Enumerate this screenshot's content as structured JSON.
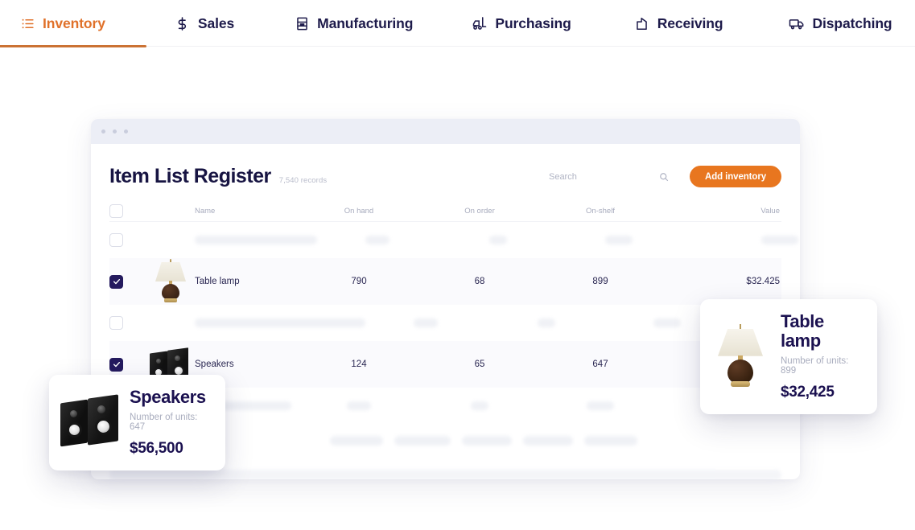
{
  "nav": {
    "items": [
      {
        "label": "Inventory",
        "icon": "list-icon",
        "active": true
      },
      {
        "label": "Sales",
        "icon": "dollar-icon",
        "active": false
      },
      {
        "label": "Manufacturing",
        "icon": "factory-rack-icon",
        "active": false
      },
      {
        "label": "Purchasing",
        "icon": "forklift-icon",
        "active": false
      },
      {
        "label": "Receiving",
        "icon": "inbox-arrow-icon",
        "active": false
      },
      {
        "label": "Dispatching",
        "icon": "truck-icon",
        "active": false
      }
    ],
    "active_color": "#e0712a"
  },
  "window": {
    "dots_count": 3
  },
  "panel": {
    "title": "Item List Register",
    "records": "7,540 records",
    "search": {
      "placeholder": "Search",
      "value": "",
      "icon": "search-icon"
    },
    "add_button": {
      "label": "Add inventory",
      "color": "#e8761f"
    }
  },
  "table": {
    "columns": [
      "Name",
      "On hand",
      "On order",
      "On-shelf",
      "Value"
    ],
    "rows": [
      {
        "name": "Table lamp",
        "on_hand": "790",
        "on_order": "68",
        "on_shelf": "899",
        "value": "$32.425",
        "checked": true,
        "thumb": "table-lamp-image"
      },
      {
        "name": "Speakers",
        "on_hand": "124",
        "on_order": "65",
        "on_shelf": "647",
        "value": "",
        "checked": true,
        "thumb": "speakers-image"
      }
    ]
  },
  "info_cards": [
    {
      "id": "lamp",
      "title": "Table lamp",
      "units": "Number of units: 899",
      "price": "$32,425",
      "thumb": "table-lamp-image"
    },
    {
      "id": "speakers",
      "title": "Speakers",
      "units": "Number of units: 647",
      "price": "$56,500",
      "thumb": "speakers-image"
    }
  ]
}
